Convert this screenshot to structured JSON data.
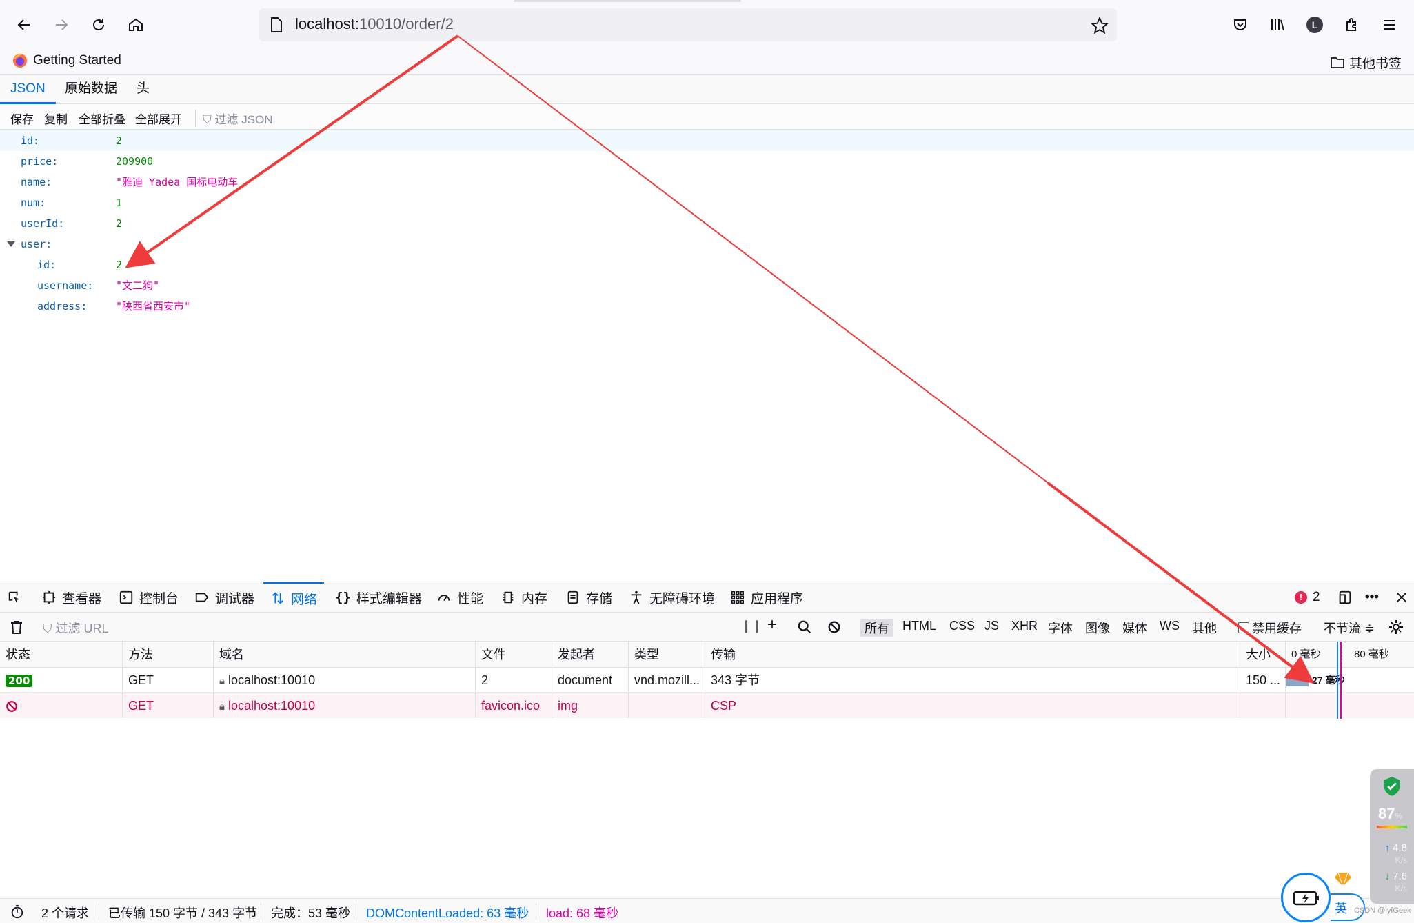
{
  "browser": {
    "url_host": "localhost:",
    "url_path": "10010/order/2",
    "bookmark": "Getting Started",
    "other_bookmarks": "其他书签",
    "profile_initial": "L"
  },
  "json_viewer": {
    "tabs": [
      "JSON",
      "原始数据",
      "头"
    ],
    "toolbar": [
      "保存",
      "复制",
      "全部折叠",
      "全部展开"
    ],
    "filter_placeholder": "过滤 JSON",
    "rows": [
      {
        "key": "id:",
        "value": "2",
        "type": "num"
      },
      {
        "key": "price:",
        "value": "209900",
        "type": "num"
      },
      {
        "key": "name:",
        "value": "\"雅迪 Yadea 国标电动车",
        "type": "str"
      },
      {
        "key": "num:",
        "value": "1",
        "type": "num"
      },
      {
        "key": "userId:",
        "value": "2",
        "type": "num"
      },
      {
        "key": "user:",
        "value": "",
        "type": "obj"
      },
      {
        "key": "id:",
        "value": "2",
        "type": "num"
      },
      {
        "key": "username:",
        "value": "\"文二狗\"",
        "type": "str"
      },
      {
        "key": "address:",
        "value": "\"陕西省西安市\"",
        "type": "str"
      }
    ]
  },
  "devtools": {
    "tabs": [
      "查看器",
      "控制台",
      "调试器",
      "网络",
      "样式编辑器",
      "性能",
      "内存",
      "存储",
      "无障碍环境",
      "应用程序"
    ],
    "error_count": "2",
    "url_filter": "过滤 URL",
    "type_filters": [
      "所有",
      "HTML",
      "CSS",
      "JS",
      "XHR",
      "字体",
      "图像",
      "媒体",
      "WS",
      "其他"
    ],
    "disable_cache": "禁用缓存",
    "throttle": "不节流 ≑",
    "columns": [
      "状态",
      "方法",
      "域名",
      "文件",
      "发起者",
      "类型",
      "传输",
      "大小",
      "0 毫秒",
      "80 毫秒"
    ],
    "requests": [
      {
        "status": "200",
        "method": "GET",
        "domain": "localhost:10010",
        "file": "2",
        "initiator": "document",
        "type": "vnd.mozill...",
        "transfer": "343 字节",
        "size": "150 ...",
        "timing": "27 毫秒"
      },
      {
        "status": "",
        "method": "GET",
        "domain": "localhost:10010",
        "file": "favicon.ico",
        "initiator": "img",
        "type": "",
        "transfer": "CSP",
        "size": "",
        "timing": ""
      }
    ],
    "statusbar": {
      "requests": "2 个请求",
      "transferred": "已传输 150 字节 / 343 字节",
      "finish": "完成：53 毫秒",
      "dcl": "DOMContentLoaded: 63 毫秒",
      "load": "load: 68 毫秒"
    }
  },
  "widgets": {
    "perf_percent": "87",
    "perf_unit": "%",
    "upload_value": "4.8",
    "upload_unit": "K/s",
    "download_value": "7.6",
    "download_unit": "K/s",
    "ime": "英",
    "watermark": "CSDN @lyfGeek"
  },
  "colors": {
    "accent": "#0074e8",
    "number": "#058b00",
    "string": "#dd00a9",
    "key": "#0a5eb1",
    "error": "#c50042",
    "annotation_arrow": "#ee3b3b"
  }
}
